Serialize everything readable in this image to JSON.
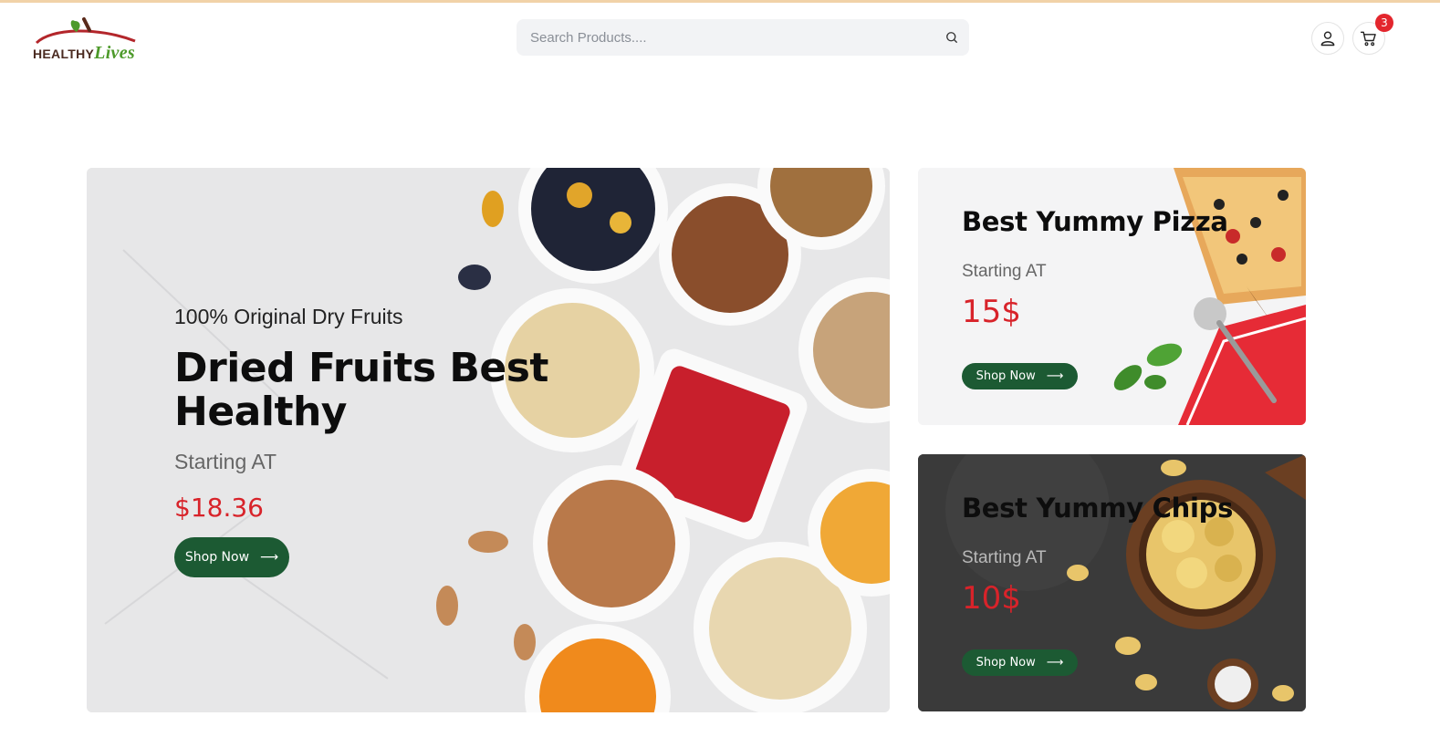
{
  "brand": {
    "logo_part1": "HEALTHY",
    "logo_part2": "Lives"
  },
  "search": {
    "placeholder": "Search Products....",
    "value": ""
  },
  "header": {
    "cart_count": "3"
  },
  "hero": {
    "subtitle": "100% Original Dry Fruits",
    "title": "Dried Fruits Best Healthy",
    "starting_label": "Starting AT",
    "price": "$18.36",
    "button_label": "Shop Now",
    "button_arrow": "⟶"
  },
  "promos": [
    {
      "title": "Best Yummy Pizza",
      "starting_label": "Starting AT",
      "price": "15$",
      "button_label": "Shop Now",
      "button_arrow": "⟶"
    },
    {
      "title": "Best Yummy Chips",
      "starting_label": "Starting AT",
      "price": "10$",
      "button_label": "Shop Now",
      "button_arrow": "⟶"
    }
  ],
  "colors": {
    "accent_green": "#1c5a33",
    "price_red": "#d8232a",
    "badge_red": "#e3262d"
  }
}
